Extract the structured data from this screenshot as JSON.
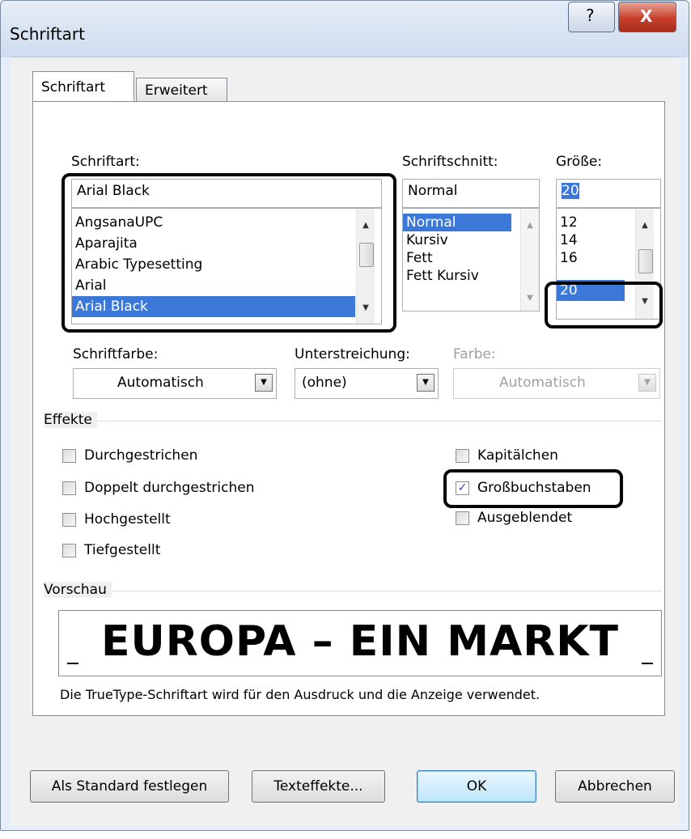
{
  "window": {
    "title": "Schriftart"
  },
  "tabs": [
    {
      "label": "Schriftart",
      "active": true
    },
    {
      "label": "Erweitert",
      "active": false
    }
  ],
  "font": {
    "label": "Schriftart:",
    "value": "Arial Black",
    "items": [
      "AngsanaUPC",
      "Aparajita",
      "Arabic Typesetting",
      "Arial",
      "Arial Black"
    ],
    "selected": "Arial Black"
  },
  "style": {
    "label": "Schriftschnitt:",
    "value": "Normal",
    "items": [
      "Normal",
      "Kursiv",
      "Fett",
      "Fett Kursiv"
    ],
    "selected": "Normal"
  },
  "size": {
    "label": "Größe:",
    "value": "20",
    "items": [
      "12",
      "14",
      "16",
      "20"
    ],
    "selected": "20"
  },
  "font_color": {
    "label": "Schriftfarbe:",
    "value": "Automatisch"
  },
  "underline": {
    "label": "Unterstreichung:",
    "value": "(ohne)"
  },
  "underline_color": {
    "label": "Farbe:",
    "value": "Automatisch",
    "disabled": true
  },
  "effects": {
    "title": "Effekte",
    "left": [
      {
        "label": "Durchgestrichen",
        "checked": false
      },
      {
        "label": "Doppelt durchgestrichen",
        "checked": false
      },
      {
        "label": "Hochgestellt",
        "checked": false
      },
      {
        "label": "Tiefgestellt",
        "checked": false
      }
    ],
    "right": [
      {
        "label": "Kapitälchen",
        "checked": false
      },
      {
        "label": "Großbuchstaben",
        "checked": true
      },
      {
        "label": "Ausgeblendet",
        "checked": false
      }
    ]
  },
  "preview": {
    "title": "Vorschau",
    "text": "EUROPA – EIN MARKT",
    "note": "Die TrueType-Schriftart wird für den Ausdruck und die Anzeige verwendet."
  },
  "buttons": {
    "set_default": "Als Standard festlegen",
    "text_effects": "Texteffekte...",
    "ok": "OK",
    "cancel": "Abbrechen"
  },
  "titlebar_buttons": {
    "help": "?",
    "close": "X"
  },
  "colors": {
    "selection": "#3c78d8",
    "highlight_border": "#000000"
  }
}
